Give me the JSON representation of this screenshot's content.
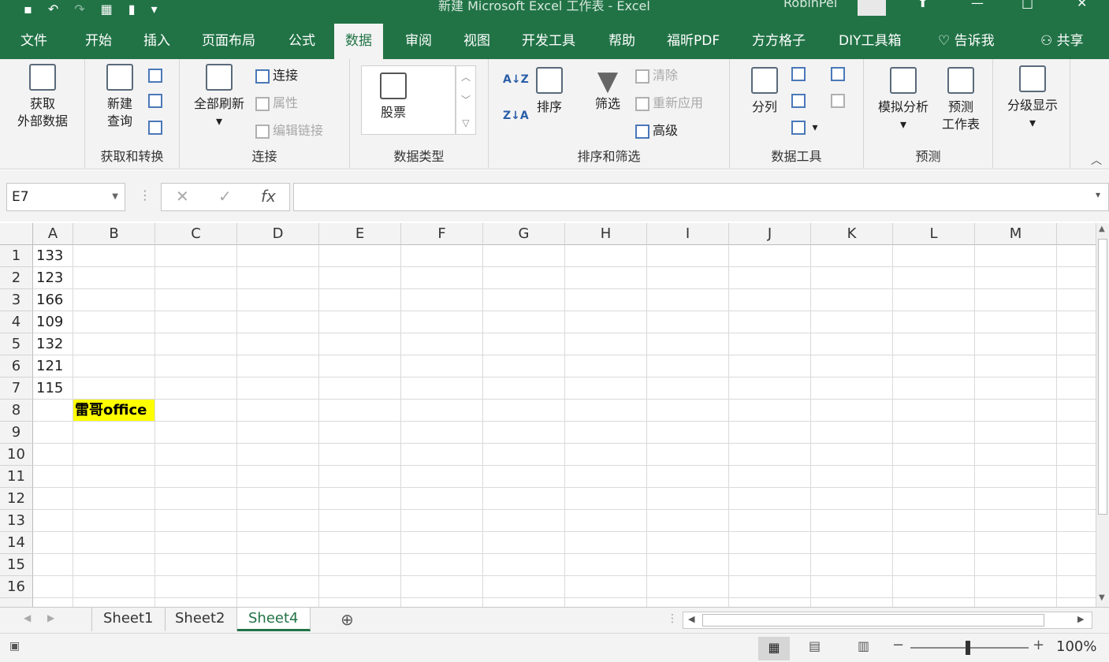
{
  "window": {
    "title": "新建 Microsoft Excel 工作表 - Excel",
    "user": "RobinPei"
  },
  "tabs": [
    "文件",
    "开始",
    "插入",
    "页面布局",
    "公式",
    "数据",
    "审阅",
    "视图",
    "开发工具",
    "帮助",
    "福昕PDF",
    "方方格子",
    "DIY工具箱",
    "告诉我",
    "共享"
  ],
  "active_tab": "数据",
  "ribbon": {
    "get_external": "获取\n外部数据",
    "new_query": "新建\n查询",
    "group_get_transform": "获取和转换",
    "refresh_all": "全部刷新",
    "connections": "连接",
    "properties": "属性",
    "edit_links": "编辑链接",
    "group_connections": "连接",
    "stocks": "股票",
    "group_datatypes": "数据类型",
    "sort": "排序",
    "filter": "筛选",
    "clear": "清除",
    "reapply": "重新应用",
    "advanced": "高级",
    "group_sort_filter": "排序和筛选",
    "text_to_columns": "分列",
    "group_datatools": "数据工具",
    "whatif": "模拟分析",
    "forecast_sheet": "预测\n工作表",
    "group_forecast": "预测",
    "outline": "分级显示"
  },
  "formula_bar": {
    "name_box": "E7",
    "fx": "fx",
    "value": ""
  },
  "columns": [
    "A",
    "B",
    "C",
    "D",
    "E",
    "F",
    "G",
    "H",
    "I",
    "J",
    "K",
    "L",
    "M"
  ],
  "rows": [
    "1",
    "2",
    "3",
    "4",
    "5",
    "6",
    "7",
    "8",
    "9",
    "10",
    "11",
    "12",
    "13",
    "14",
    "15",
    "16"
  ],
  "cells": {
    "A1": "133",
    "A2": "123",
    "A3": "166",
    "A4": "109",
    "A5": "132",
    "A6": "121",
    "A7": "115",
    "B8": "雷哥office"
  },
  "colors": {
    "accent": "#217346",
    "highlight": "#ffff00"
  },
  "sheets": [
    "Sheet1",
    "Sheet2",
    "Sheet4"
  ],
  "active_sheet": "Sheet4",
  "zoom": "100%"
}
